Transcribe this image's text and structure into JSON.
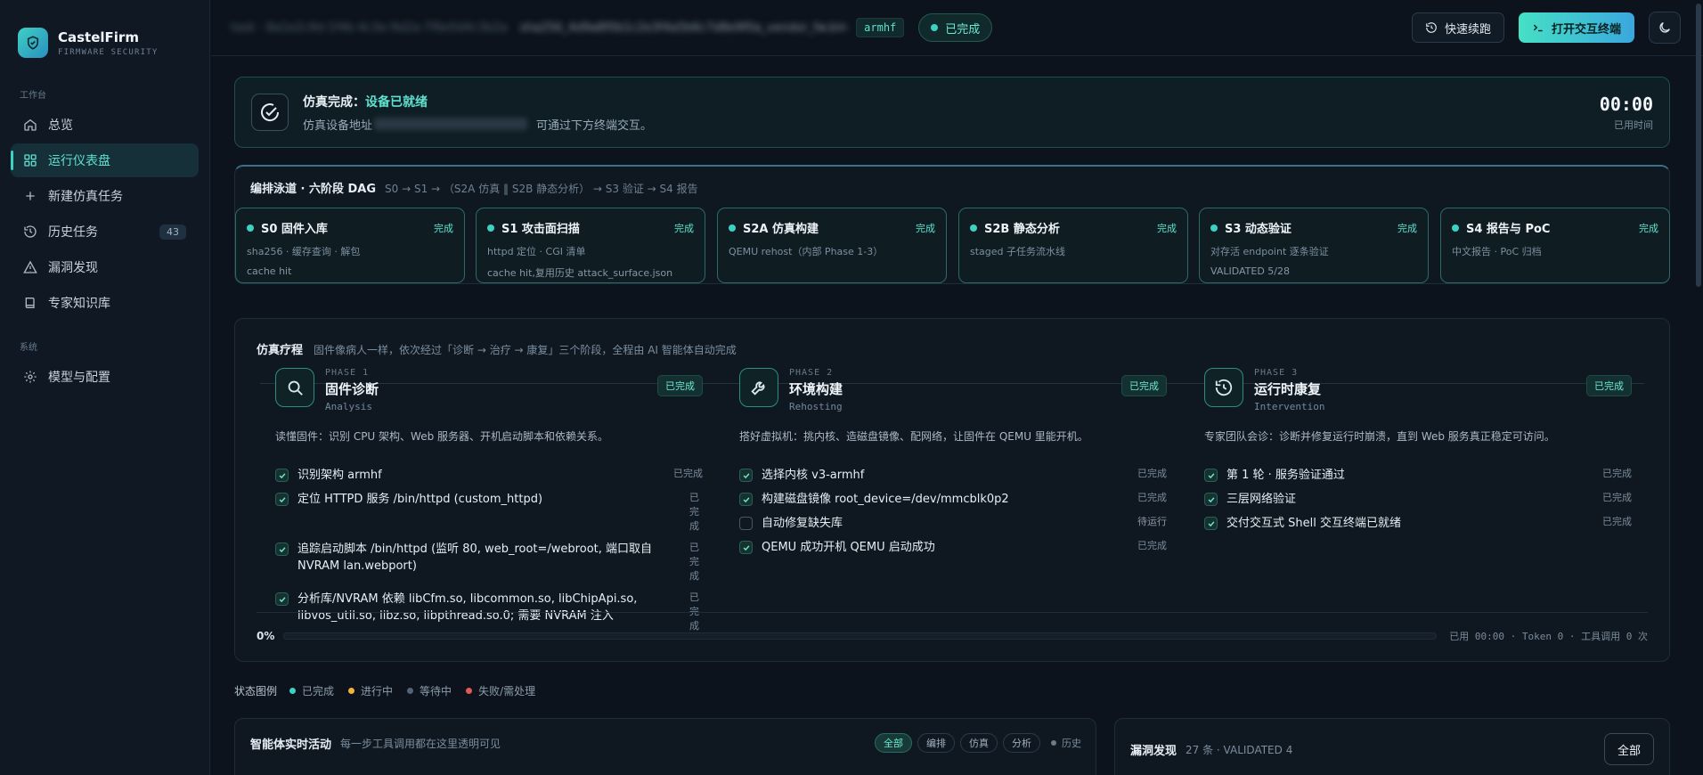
{
  "brand": {
    "name": "CastelFirm",
    "subtitle": "FIRMWARE SECURITY"
  },
  "sidebar": {
    "group_workspace": "工作台",
    "group_system": "系统",
    "items": [
      {
        "label": "总览",
        "icon": "home-icon"
      },
      {
        "label": "运行仪表盘",
        "icon": "dashboard-icon",
        "active": true
      },
      {
        "label": "新建仿真任务",
        "icon": "plus-icon"
      },
      {
        "label": "历史任务",
        "icon": "history-icon",
        "badge": "43"
      },
      {
        "label": "漏洞发现",
        "icon": "warning-icon"
      },
      {
        "label": "专家知识库",
        "icon": "book-icon"
      },
      {
        "label": "模型与配置",
        "icon": "gear-icon"
      }
    ]
  },
  "topbar": {
    "blurred_id_1": "task · 8a1e2c9d-1f4b-4c3e-9d2a-7f6e5d4c3b2a",
    "blurred_id_2": "sha256_4d9a8f0b1c2e3f4a5b6c7d8e9f0a_vendor_fw.bin",
    "arch": "armhf",
    "status": "已完成",
    "resume_label": "快速续跑",
    "terminal_label": "打开交互终端"
  },
  "banner": {
    "title_prefix": "仿真完成：",
    "title_accent": "设备已就绪",
    "sub_prefix": "仿真设备地址",
    "sub_suffix": "可通过下方终端交互。",
    "timer": "00:00",
    "timer_label": "已用时间"
  },
  "dag": {
    "title": "编排泳道 · 六阶段 DAG",
    "subtitle": "S0 → S1 → （S2A 仿真 ‖ S2B 静态分析） → S3 验证 → S4 报告",
    "stages": [
      {
        "title": "S0 固件入库",
        "status": "完成",
        "line1": "sha256 · 缓存查询 · 解包",
        "line2": "cache hit"
      },
      {
        "title": "S1 攻击面扫描",
        "status": "完成",
        "line1": "httpd 定位 · CGI 清单",
        "line2": "cache hit,复用历史 attack_surface.json"
      },
      {
        "title": "S2A 仿真构建",
        "status": "完成",
        "line1": "QEMU rehost（内部 Phase 1-3）",
        "line2": ""
      },
      {
        "title": "S2B 静态分析",
        "status": "完成",
        "line1": "staged 子任务流水线",
        "line2": ""
      },
      {
        "title": "S3 动态验证",
        "status": "完成",
        "line1": "对存活 endpoint 逐条验证",
        "line2": "VALIDATED 5/28"
      },
      {
        "title": "S4 报告与 PoC",
        "status": "完成",
        "line1": "中文报告 · PoC 归档",
        "line2": ""
      }
    ]
  },
  "journey": {
    "title": "仿真疗程",
    "subtitle": "固件像病人一样，依次经过「诊断 → 治疗 → 康复」三个阶段，全程由 AI 智能体自动完成",
    "phases": [
      {
        "kicker": "PHASE 1",
        "name": "固件诊断",
        "en": "Analysis",
        "badge": "已完成",
        "desc": "读懂固件：识别 CPU 架构、Web 服务器、开机启动脚本和依赖关系。",
        "tasks": [
          {
            "text": "识别架构 armhf",
            "state": "已完成",
            "done": true
          },
          {
            "text": "定位 HTTPD 服务 /bin/httpd (custom_httpd)",
            "state": "已完成",
            "done": true
          },
          {
            "text": "追踪启动脚本 /bin/httpd (监听 80, web_root=/webroot, 端口取自 NVRAM lan.webport)",
            "state": "已完成",
            "done": true
          },
          {
            "text": "分析库/NVRAM 依赖 libCfm.so, libcommon.so, libChipApi.so, libvos_util.so, libz.so, libpthread.so.0; 需要 NVRAM 注入",
            "state": "已完成",
            "done": true
          }
        ]
      },
      {
        "kicker": "PHASE 2",
        "name": "环境构建",
        "en": "Rehosting",
        "badge": "已完成",
        "desc": "搭好虚拟机：挑内核、造磁盘镜像、配网络，让固件在 QEMU 里能开机。",
        "tasks": [
          {
            "text": "选择内核 v3-armhf",
            "state": "已完成",
            "done": true
          },
          {
            "text": "构建磁盘镜像 root_device=/dev/mmcblk0p2",
            "state": "已完成",
            "done": true
          },
          {
            "text": "自动修复缺失库",
            "state": "待运行",
            "done": false
          },
          {
            "text": "QEMU 成功开机 QEMU 启动成功",
            "state": "已完成",
            "done": true
          }
        ]
      },
      {
        "kicker": "PHASE 3",
        "name": "运行时康复",
        "en": "Intervention",
        "badge": "已完成",
        "desc": "专家团队会诊：诊断并修复运行时崩溃，直到 Web 服务真正稳定可访问。",
        "tasks": [
          {
            "text": "第 1 轮 · 服务验证通过",
            "state": "已完成",
            "done": true
          },
          {
            "text": "三层网络验证",
            "state": "已完成",
            "done": true
          },
          {
            "text": "交付交互式 Shell 交互终端已就绪",
            "state": "已完成",
            "done": true
          }
        ]
      }
    ],
    "progress_pct": "0%",
    "progress_value": 0,
    "stats": "已用 00:00 · Token 0 · 工具调用 0 次"
  },
  "legend": {
    "title": "状态图例",
    "items": [
      {
        "label": "已完成",
        "color": "#3fd0c4"
      },
      {
        "label": "进行中",
        "color": "#f0b43a"
      },
      {
        "label": "等待中",
        "color": "#556474"
      },
      {
        "label": "失败/需处理",
        "color": "#e05a5a"
      }
    ]
  },
  "activity": {
    "title": "智能体实时活动",
    "subtitle": "每一步工具调用都在这里透明可见",
    "filters": [
      "全部",
      "编排",
      "仿真",
      "分析"
    ],
    "history": "历史"
  },
  "vulns": {
    "title": "漏洞发现",
    "subtitle": "27 条 · VALIDATED 4",
    "button": "全部"
  },
  "colors": {
    "accent": "#3fd0c4",
    "bg": "#0c131c",
    "panel": "#0f1821"
  }
}
